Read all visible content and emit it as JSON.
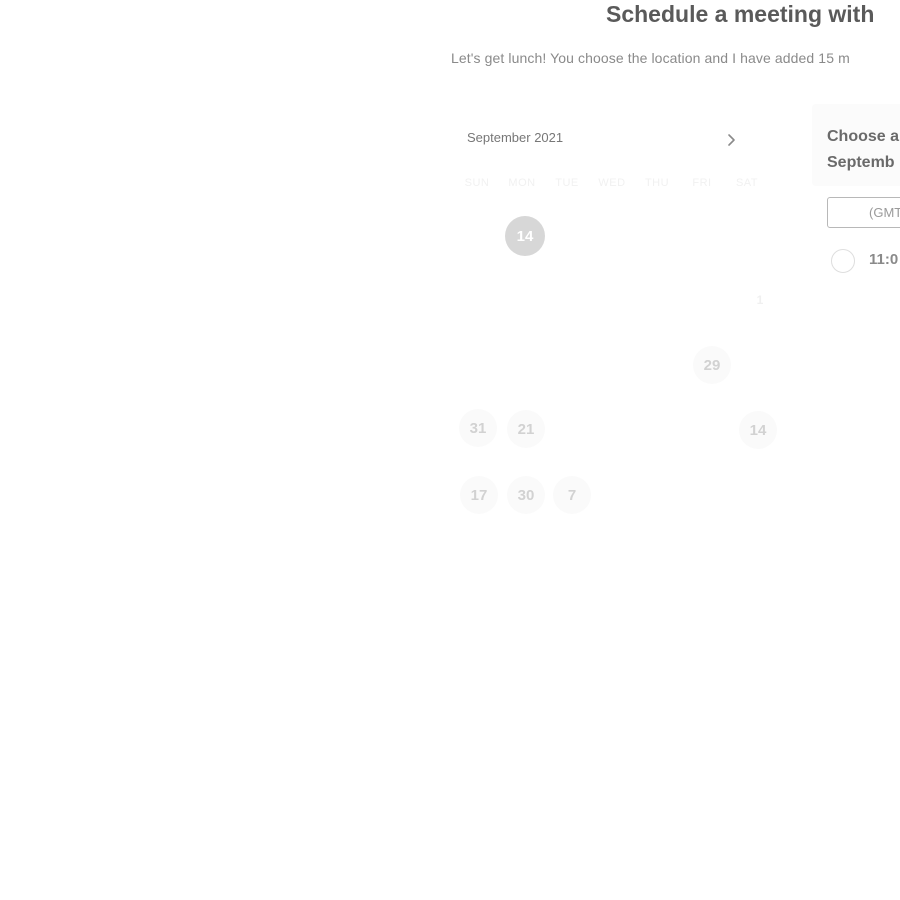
{
  "header": {
    "title": "Schedule a meeting with",
    "subtitle": "Let's get lunch! You choose the location and I have added 15 m"
  },
  "calendar": {
    "month_label": "September 2021",
    "next_icon": "chevron-right-icon",
    "weekdays": [
      "SUN",
      "MON",
      "TUE",
      "WED",
      "THU",
      "FRI",
      "SAT"
    ],
    "selected_day": "14",
    "days": [
      {
        "label": "14",
        "selected": true
      },
      {
        "label": "29",
        "selected": false
      },
      {
        "label": "31",
        "selected": false
      },
      {
        "label": "21",
        "selected": false
      },
      {
        "label": "14",
        "selected": false
      },
      {
        "label": "17",
        "selected": false
      },
      {
        "label": "30",
        "selected": false
      },
      {
        "label": "7",
        "selected": false
      }
    ],
    "ghost_marks": [
      "1"
    ]
  },
  "slots_panel": {
    "heading_line1": "Choose a",
    "heading_line2": "Septemb",
    "timezone_value": "(GMT",
    "slots": [
      {
        "time": "11:0"
      }
    ]
  },
  "colors": {
    "title": "#5a5a5a",
    "selected_day_bg": "#d7d7d7",
    "day_text": "#d2d2d2"
  }
}
